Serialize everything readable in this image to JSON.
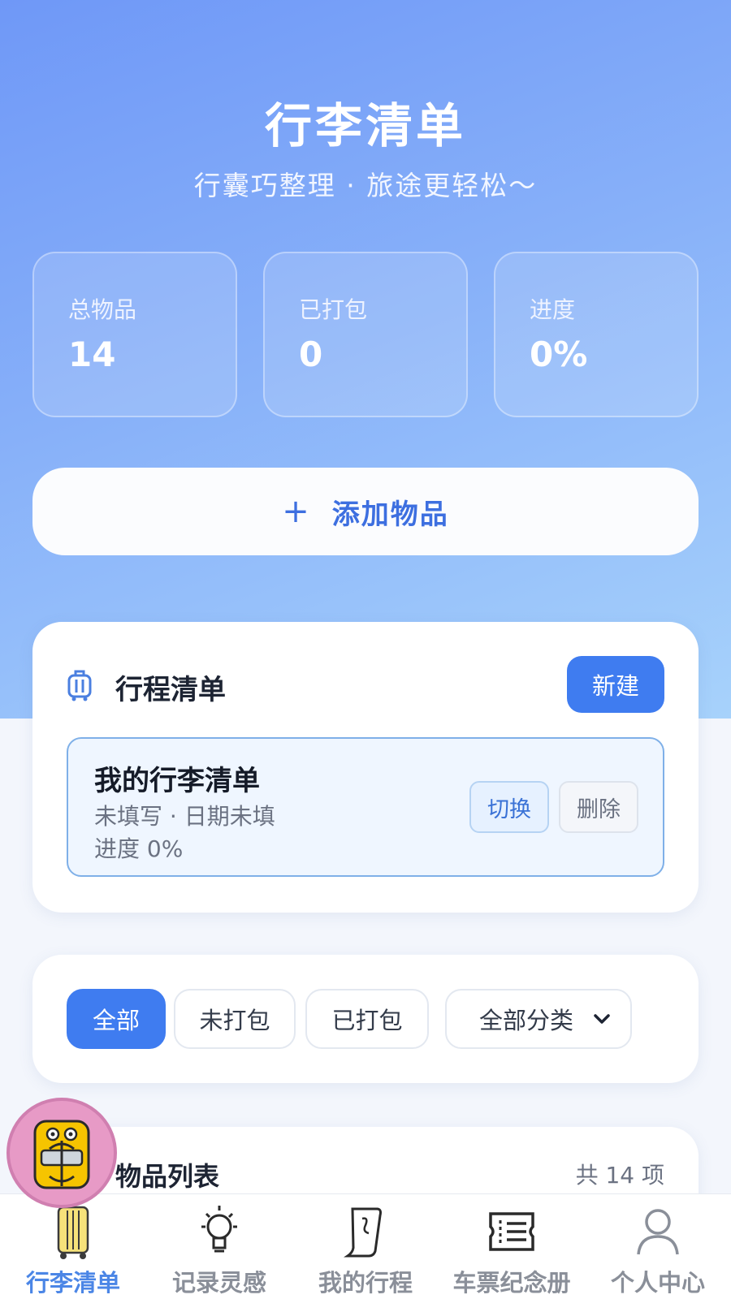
{
  "header": {
    "title": "行李清单",
    "subtitle": "行囊巧整理 · 旅途更轻松～"
  },
  "stats": [
    {
      "label": "总物品",
      "value": "14"
    },
    {
      "label": "已打包",
      "value": "0"
    },
    {
      "label": "进度",
      "value": "0%"
    }
  ],
  "add_button": {
    "icon": "plus-icon",
    "label": "添加物品"
  },
  "trip_panel": {
    "icon": "luggage-icon",
    "title": "行程清单",
    "new_label": "新建",
    "item": {
      "name": "我的行李清单",
      "meta": "未填写 · 日期未填",
      "progress": "进度 0%",
      "switch_label": "切换",
      "delete_label": "删除"
    }
  },
  "filters": {
    "chips": [
      "全部",
      "未打包",
      "已打包"
    ],
    "active": "全部",
    "category_selected": "全部分类"
  },
  "item_list": {
    "title": "物品列表",
    "count": "共 14 项"
  },
  "colors": {
    "accent": "#3f7cf0",
    "hero_start": "#6f98f7",
    "hero_end": "#a7d2fb",
    "active_tab": "#4b86e6"
  },
  "tabbar": [
    {
      "label": "行李清单",
      "icon": "suitcase-icon",
      "active": true
    },
    {
      "label": "记录灵感",
      "icon": "lightbulb-icon",
      "active": false
    },
    {
      "label": "我的行程",
      "icon": "scroll-map-icon",
      "active": false
    },
    {
      "label": "车票纪念册",
      "icon": "ticket-icon",
      "active": false
    },
    {
      "label": "个人中心",
      "icon": "user-icon",
      "active": false
    }
  ]
}
